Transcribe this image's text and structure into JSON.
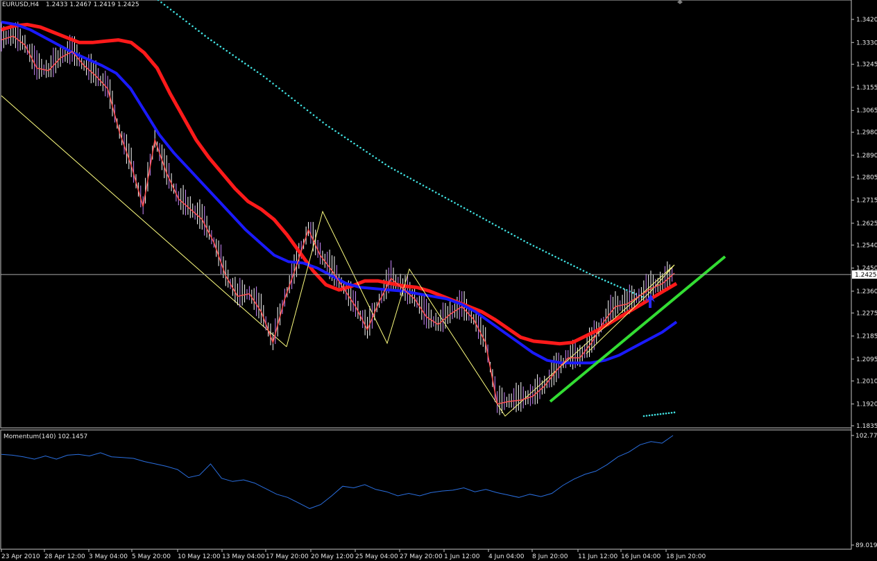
{
  "header": {
    "symbol_timeframe": "EURUSD,H4",
    "ohlc": "1.2433 1.2467 1.2419 1.2425"
  },
  "indicator": {
    "label": "Momentum(140) 102.1457"
  },
  "colors": {
    "background": "#000000",
    "frame": "#c8c8c8",
    "price_line": "#ff5050",
    "bar_bull": "#ffffff",
    "bar_bear": "#cc88ff",
    "ma_red": "#ff1a1a",
    "ma_blue": "#1a1aff",
    "dotted_cyan": "#40e0e0",
    "zigzag": "#ffff80",
    "trend_green": "#33dd33",
    "momentum": "#2a6fe0",
    "arrow_blue": "#2a2aff"
  },
  "chart_data": {
    "type": "line",
    "price_axis": {
      "ticks": [
        "1.3420",
        "1.3330",
        "1.3245",
        "1.3155",
        "1.3065",
        "1.2980",
        "1.2890",
        "1.2805",
        "1.2715",
        "1.2625",
        "1.2540",
        "1.2450",
        "1.2360",
        "1.2275",
        "1.2185",
        "1.2095",
        "1.2010",
        "1.1920",
        "1.1835"
      ],
      "ylim": [
        1.1835,
        1.345
      ],
      "current_price": "1.2425"
    },
    "momentum_axis": {
      "ticks": [
        "102.770",
        "89.0191"
      ],
      "ylim": [
        89.0191,
        102.77
      ]
    },
    "time_axis": {
      "ticks": [
        "23 Apr 2010",
        "28 Apr 12:00",
        "3 May 04:00",
        "5 May 20:00",
        "10 May 12:00",
        "13 May 04:00",
        "17 May 20:00",
        "20 May 12:00",
        "25 May 04:00",
        "27 May 20:00",
        "1 Jun 12:00",
        "4 Jun 04:00",
        "8 Jun 20:00",
        "11 Jun 12:00",
        "16 Jun 04:00",
        "18 Jun 20:00"
      ]
    },
    "series": [
      {
        "values": [
          1.338,
          1.3395,
          1.34,
          1.339,
          1.337,
          1.335,
          1.333,
          1.333,
          1.3335,
          1.334,
          1.333,
          1.329,
          1.323,
          1.313,
          1.304,
          1.295,
          1.288,
          1.282,
          1.276,
          1.271,
          1.268,
          1.264,
          1.258,
          1.251,
          1.244,
          1.2385,
          1.2365,
          1.238,
          1.24,
          1.24,
          1.239,
          1.238,
          1.2375,
          1.236,
          1.234,
          1.232,
          1.23,
          1.228,
          1.225,
          1.2215,
          1.218,
          1.2165,
          1.216,
          1.2155,
          1.216,
          1.2185,
          1.221,
          1.224,
          1.227,
          1.23,
          1.233,
          1.236,
          1.239
        ]
      },
      {
        "values": [
          1.341,
          1.34,
          1.338,
          1.335,
          1.332,
          1.329,
          1.3265,
          1.324,
          1.321,
          1.315,
          1.306,
          1.297,
          1.29,
          1.284,
          1.278,
          1.272,
          1.266,
          1.26,
          1.255,
          1.25,
          1.2475,
          1.247,
          1.245,
          1.242,
          1.239,
          1.2375,
          1.237,
          1.2365,
          1.236,
          1.235,
          1.234,
          1.233,
          1.231,
          1.228,
          1.224,
          1.22,
          1.216,
          1.212,
          1.209,
          1.208,
          1.208,
          1.208,
          1.209,
          1.211,
          1.214,
          1.217,
          1.22,
          1.224
        ]
      },
      {
        "values": [
          1.334,
          1.3355,
          1.332,
          1.323,
          1.322,
          1.327,
          1.3295,
          1.324,
          1.32,
          1.315,
          1.298,
          1.285,
          1.269,
          1.295,
          1.282,
          1.272,
          1.268,
          1.264,
          1.255,
          1.242,
          1.234,
          1.235,
          1.228,
          1.216,
          1.233,
          1.246,
          1.26,
          1.25,
          1.244,
          1.237,
          1.23,
          1.221,
          1.232,
          1.241,
          1.237,
          1.233,
          1.226,
          1.223,
          1.227,
          1.23,
          1.225,
          1.216,
          1.192,
          1.193,
          1.1935,
          1.195,
          1.199,
          1.205,
          1.21,
          1.21,
          1.216,
          1.224,
          1.23,
          1.231,
          1.234,
          1.237,
          1.239,
          1.243
        ]
      },
      {
        "values": [
          100.4,
          100.3,
          100.1,
          99.8,
          100.2,
          99.8,
          100.3,
          100.4,
          100.2,
          100.6,
          100.1,
          100.0,
          99.9,
          99.5,
          99.2,
          98.9,
          98.5,
          97.5,
          97.8,
          99.2,
          97.4,
          97.0,
          97.2,
          96.8,
          96.1,
          95.4,
          95.0,
          94.3,
          93.6,
          94.1,
          95.2,
          96.4,
          96.2,
          96.6,
          96.0,
          95.7,
          95.2,
          95.5,
          95.2,
          95.6,
          95.8,
          95.9,
          96.2,
          95.7,
          96.0,
          95.6,
          95.3,
          95.0,
          95.4,
          95.1,
          95.5,
          96.5,
          97.3,
          97.9,
          98.3,
          99.1,
          100.1,
          100.7,
          101.6,
          102.0,
          101.8,
          102.77
        ]
      }
    ]
  }
}
